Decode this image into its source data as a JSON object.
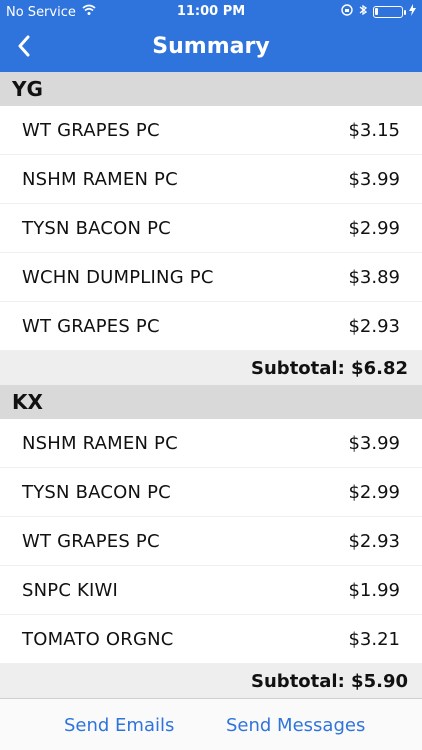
{
  "status": {
    "carrier": "No Service",
    "time": "11:00 PM",
    "battery_level": 0.1
  },
  "nav": {
    "title": "Summary",
    "back_icon": "chevron-left-icon"
  },
  "sections": [
    {
      "title": "YG",
      "items": [
        {
          "name": "WT GRAPES PC",
          "price": "$3.15"
        },
        {
          "name": "NSHM RAMEN PC",
          "price": "$3.99"
        },
        {
          "name": "TYSN BACON PC",
          "price": "$2.99"
        },
        {
          "name": "WCHN DUMPLING PC",
          "price": "$3.89"
        },
        {
          "name": "WT GRAPES PC",
          "price": "$2.93"
        }
      ],
      "subtotal": "Subtotal: $6.82"
    },
    {
      "title": "KX",
      "items": [
        {
          "name": "NSHM RAMEN PC",
          "price": "$3.99"
        },
        {
          "name": "TYSN BACON PC",
          "price": "$2.99"
        },
        {
          "name": "WT GRAPES PC",
          "price": "$2.93"
        },
        {
          "name": "SNPC KIWI",
          "price": "$1.99"
        },
        {
          "name": "TOMATO ORGNC",
          "price": "$3.21"
        }
      ],
      "subtotal": "Subtotal: $5.90"
    }
  ],
  "actions": {
    "send_emails": "Send Emails",
    "send_messages": "Send Messages"
  },
  "colors": {
    "accent": "#2f74dc",
    "section_bg": "#d9d9d9",
    "subtotal_bg": "#eeeeee"
  }
}
